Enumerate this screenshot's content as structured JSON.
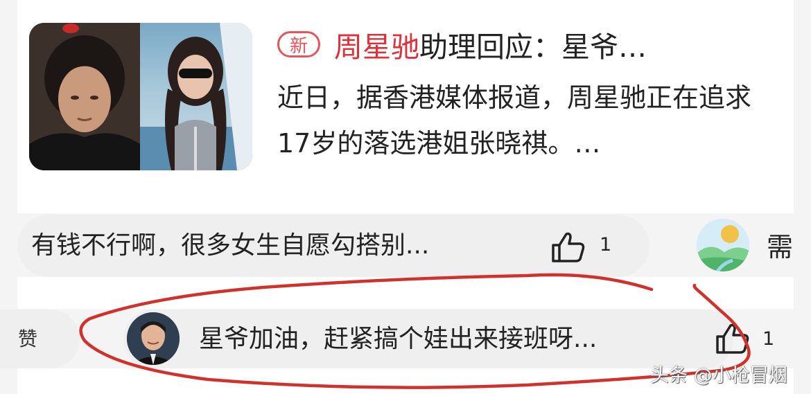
{
  "news": {
    "badge": "新",
    "title_highlight": "周星驰",
    "title_rest": "助理回应：星爷…",
    "summary": "近日，据香港媒体报道，周星驰正在追求17岁的落选港姐张晓祺。…"
  },
  "comment1": {
    "text": "有钱不行啊，很多女生自愿勾搭别...",
    "likes": "1",
    "side_text": "需"
  },
  "comment2": {
    "left_label": "赞",
    "text": "星爷加油，赶紧搞个娃出来接班呀...",
    "likes": "1"
  },
  "watermark": "头条 @小枪冒烟",
  "colors": {
    "highlight": "#e0303a",
    "annotation": "#d2312b"
  }
}
